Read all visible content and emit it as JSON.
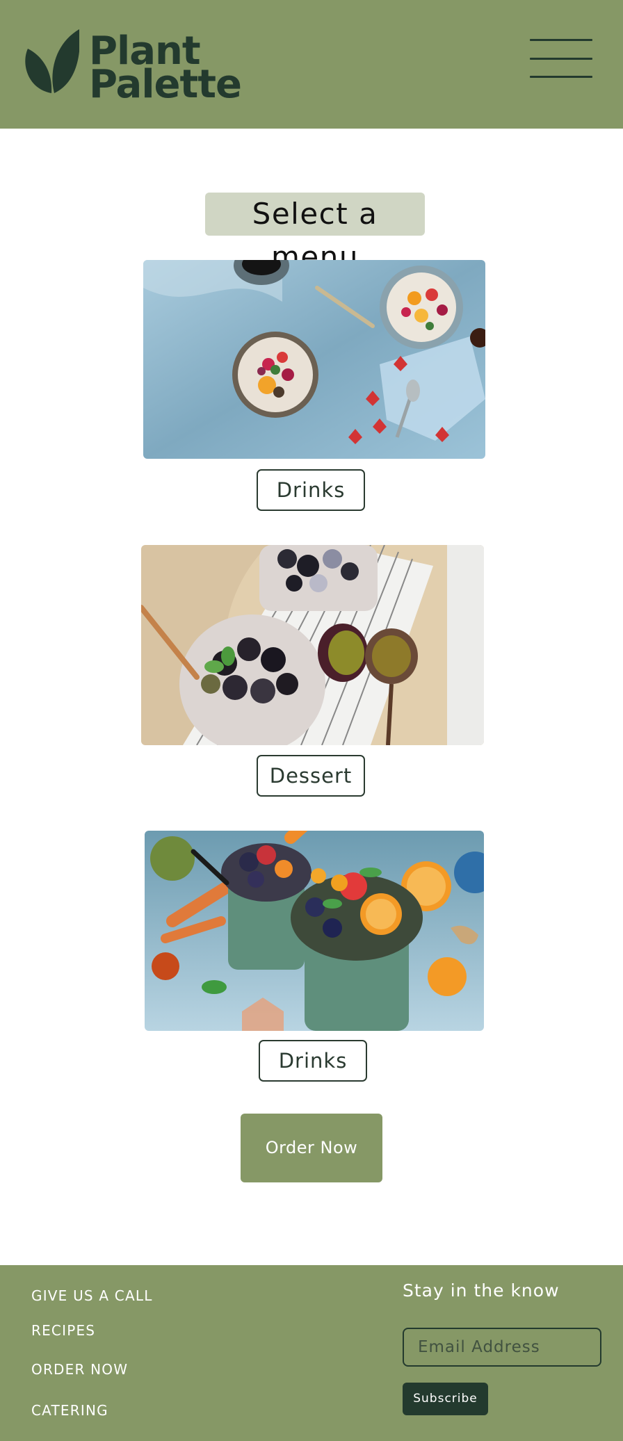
{
  "header": {
    "brand_line1": "Plant",
    "brand_line2": "Palette",
    "menu_icon": "hamburger-icon",
    "logo_icon": "leaf-icon"
  },
  "main": {
    "title": "Select a menu",
    "cards": [
      {
        "label": "Drinks"
      },
      {
        "label": "Dessert"
      },
      {
        "label": "Drinks"
      }
    ],
    "order_button": "Order Now"
  },
  "footer": {
    "links": [
      "GIVE US A CALL",
      "RECIPES",
      "ORDER NOW",
      "CATERING"
    ],
    "newsletter_title": "Stay in the know",
    "email_placeholder": "Email Address",
    "subscribe_label": "Subscribe"
  },
  "colors": {
    "brand_green": "#869866",
    "dark_green": "#233a2e",
    "title_bg": "#d0d6c4"
  }
}
